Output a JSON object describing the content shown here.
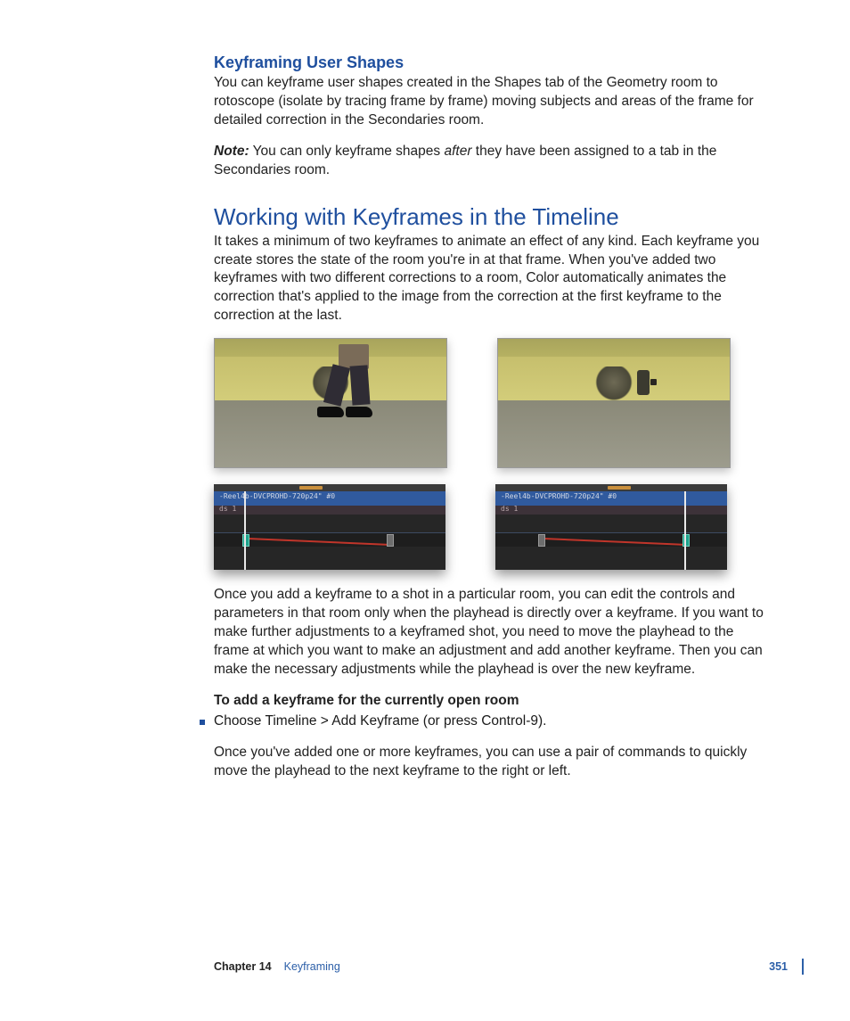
{
  "section1": {
    "heading": "Keyframing User Shapes",
    "p1": "You can keyframe user shapes created in the Shapes tab of the Geometry room to rotoscope (isolate by tracing frame by frame) moving subjects and areas of the frame for detailed correction in the Secondaries room.",
    "note_label": "Note:",
    "note_a": "  You can only keyframe shapes ",
    "note_em": "after",
    "note_b": " they have been assigned to a tab in the Secondaries room."
  },
  "section2": {
    "heading": "Working with Keyframes in the Timeline",
    "p1": "It takes a minimum of two keyframes to animate an effect of any kind. Each keyframe you create stores the state of the room you're in at that frame. When you've added two keyframes with two different corrections to a room, Color automatically animates the correction that's applied to the image from the correction at the first keyframe to the correction at the last.",
    "clip_label_a": "-Reel4b-DVCPROHD-720p24\" #0",
    "clip_label_b": "-Reel4b-DVCPROHD-720p24\" #0",
    "track_label": "ds 1",
    "p2": "Once you add a keyframe to a shot in a particular room, you can edit the controls and parameters in that room only when the playhead is directly over a keyframe. If you want to make further adjustments to a keyframed shot, you need to move the playhead to the frame at which you want to make an adjustment and add another keyframe. Then you can make the necessary adjustments while the playhead is over the new keyframe.",
    "task": "To add a keyframe for the currently open room",
    "bullet": "Choose Timeline > Add Keyframe (or press Control-9).",
    "p3": "Once you've added one or more keyframes, you can use a pair of commands to quickly move the playhead to the next keyframe to the right or left."
  },
  "footer": {
    "chapter": "Chapter 14",
    "name": "Keyframing",
    "page": "351"
  }
}
